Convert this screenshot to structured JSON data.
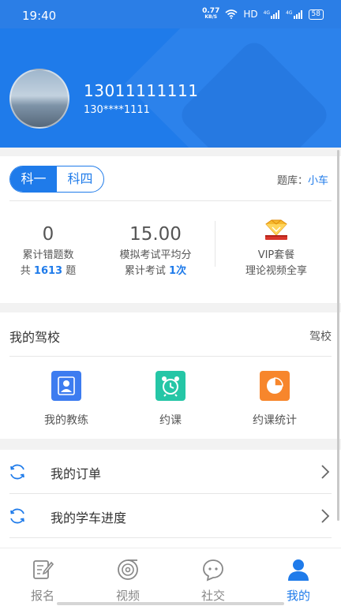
{
  "status": {
    "time": "19:40",
    "net_speed": "0.77",
    "net_unit": "KB/S",
    "hd": "HD",
    "sig1": "4G",
    "sig2": "4G",
    "battery": "58"
  },
  "profile": {
    "phone": "13011111111",
    "phone_masked": "130****1111"
  },
  "subjects": {
    "tab1": "科一",
    "tab2": "科四",
    "active": "科一"
  },
  "bank": {
    "label": "题库：",
    "value": "小车"
  },
  "stats": {
    "wrong_count": "0",
    "wrong_label": "累计错题数",
    "total_prefix": "共",
    "total_value": "1613",
    "total_suffix": "题",
    "avg_score": "15.00",
    "avg_label": "模拟考试平均分",
    "exams_prefix": "累计考试",
    "exams_value": "1次"
  },
  "vip": {
    "line1": "VIP套餐",
    "line2": "理论视频全享"
  },
  "school": {
    "title": "我的驾校",
    "more": "驾校",
    "items": [
      {
        "label": "我的教练",
        "icon": "coach-icon",
        "color": "#3d7cf0"
      },
      {
        "label": "约课",
        "icon": "alarm-clock-icon",
        "color": "#25c6a6"
      },
      {
        "label": "约课统计",
        "icon": "pie-chart-icon",
        "color": "#f7862c"
      }
    ]
  },
  "menu": [
    {
      "label": "我的订单",
      "icon": "refresh-icon"
    },
    {
      "label": "我的学车进度",
      "icon": "refresh-icon"
    }
  ],
  "tabs": [
    {
      "label": "报名",
      "icon": "edit-icon"
    },
    {
      "label": "视频",
      "icon": "video-icon"
    },
    {
      "label": "社交",
      "icon": "chat-icon"
    },
    {
      "label": "我的",
      "icon": "user-icon",
      "active": true
    }
  ],
  "colors": {
    "primary": "#1f7bea",
    "background": "#f2f2f2"
  }
}
